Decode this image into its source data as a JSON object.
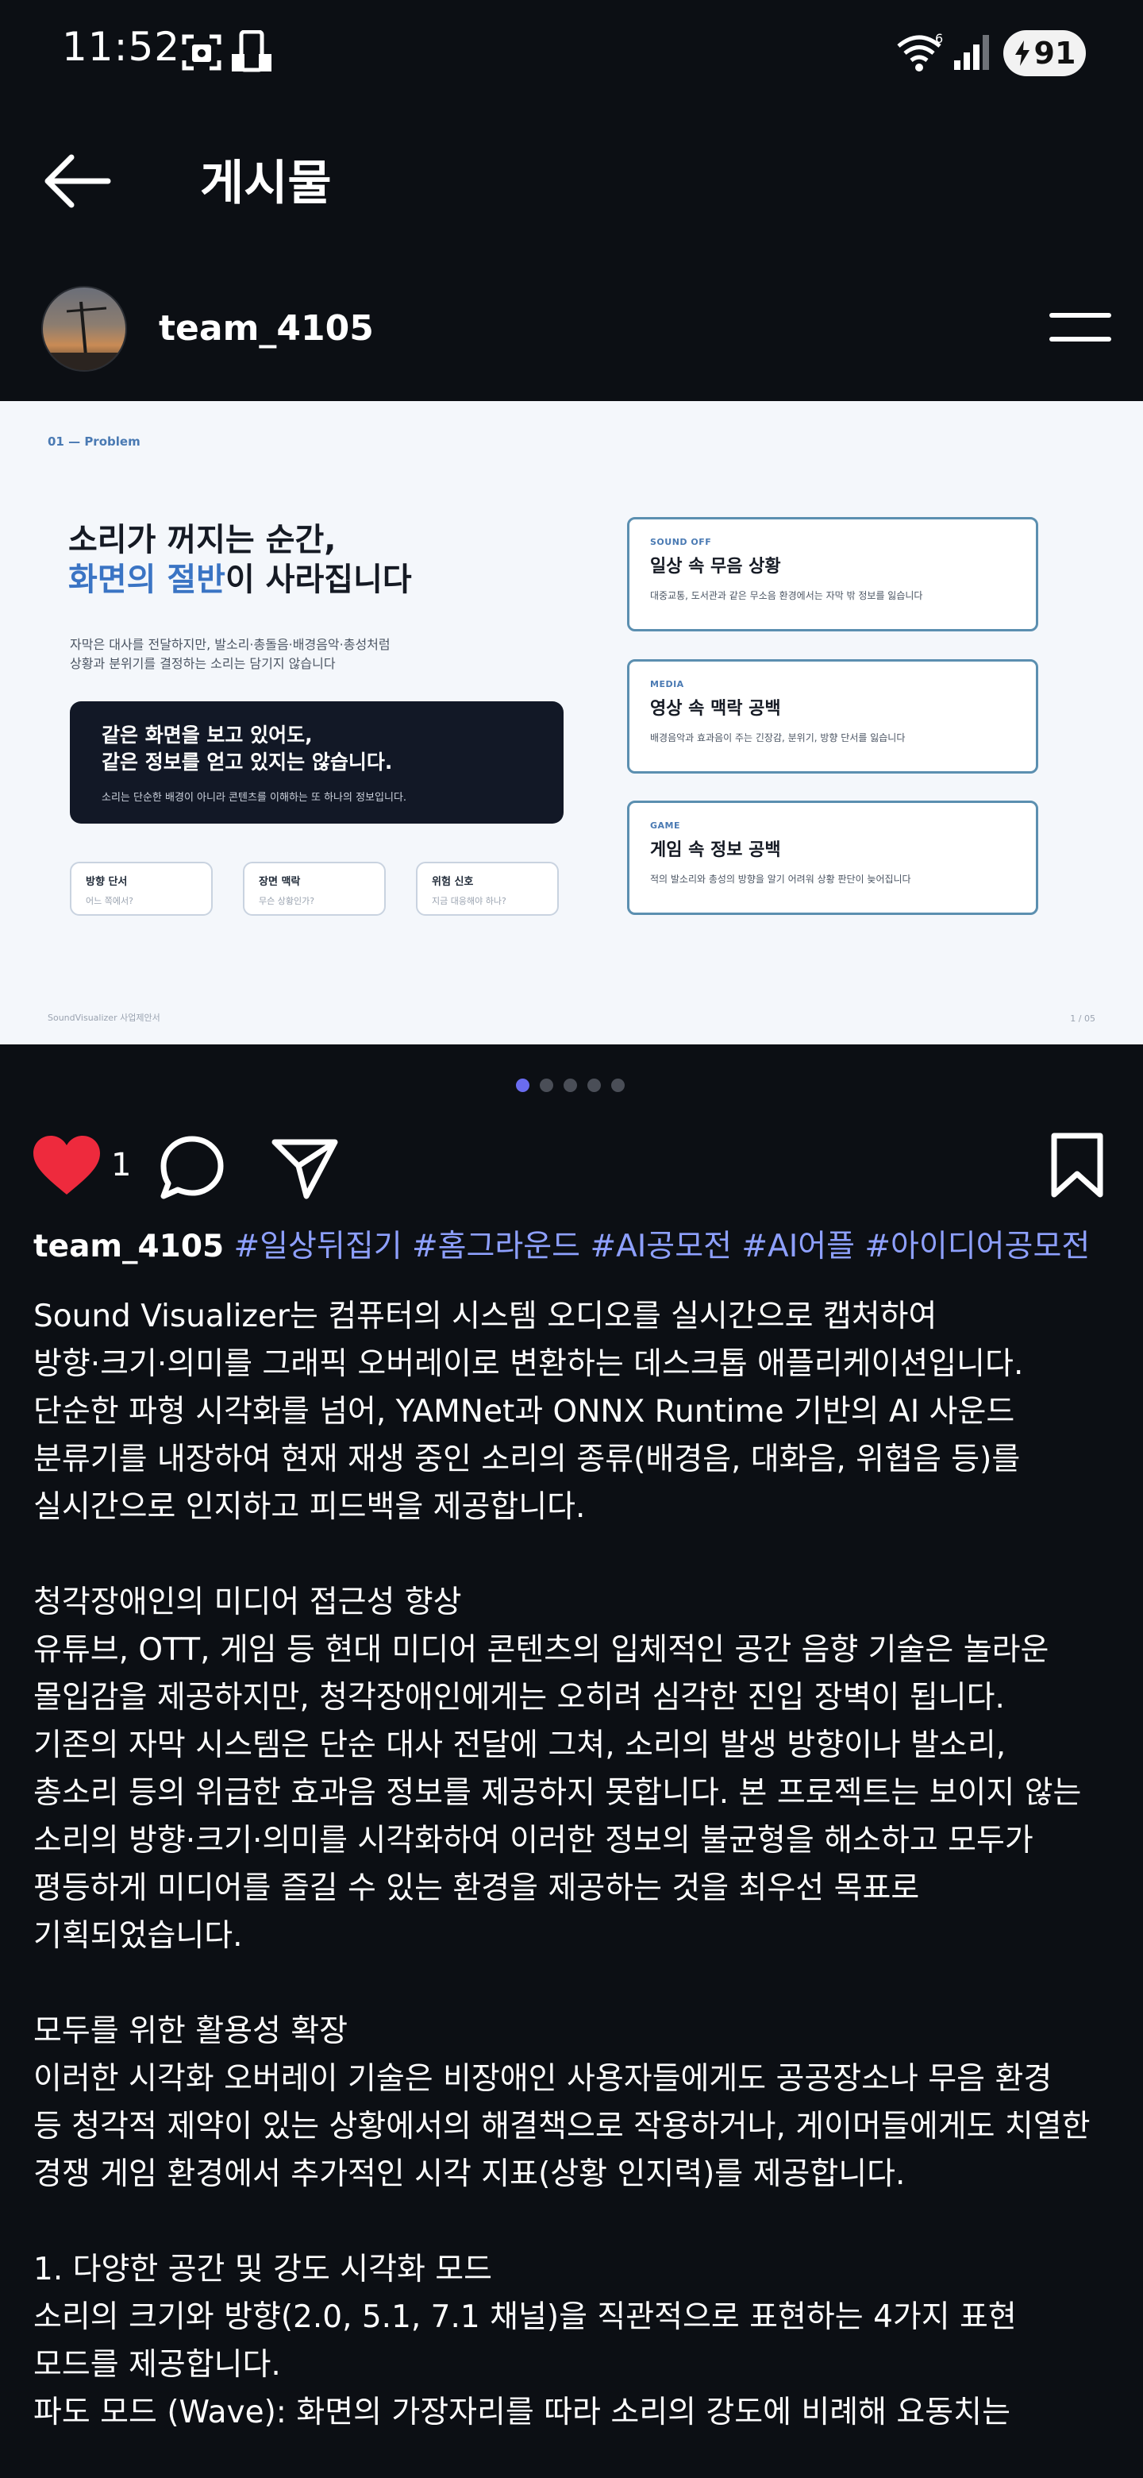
{
  "status_bar": {
    "time": "11:52",
    "battery": "91",
    "icons": [
      "screenshot-icon",
      "phone-settings-icon",
      "wifi-icon",
      "signal-icon",
      "battery-charging-icon"
    ]
  },
  "header": {
    "title": "게시물",
    "back_icon": "arrow-left-icon"
  },
  "author": {
    "username": "team_4105",
    "menu_icon": "hamburger-menu-icon"
  },
  "slide": {
    "kicker": "01 — Problem",
    "headline_line1": "소리가 꺼지는 순간,",
    "headline_line2_blue": "화면의 절반",
    "headline_line2_rest": "이 사라집니다",
    "sub_line1": "자막은 대사를 전달하지만, 발소리·총돌음·배경음악·총성처럼",
    "sub_line2": "상황과 분위기를 결정하는 소리는 담기지 않습니다",
    "box_line1": "같은 화면을 보고 있어도,",
    "box_line2": "같은 정보를 얻고 있지는 않습니다.",
    "box_note": "소리는 단순한 배경이 아니라 콘텐츠를 이해하는 또 하나의 정보입니다.",
    "pills": [
      {
        "title": "방향 단서",
        "sub": "어느 쪽에서?"
      },
      {
        "title": "장면 맥락",
        "sub": "무슨 상황인가?"
      },
      {
        "title": "위험 신호",
        "sub": "지금 대응해야 하나?"
      }
    ],
    "cards": [
      {
        "kicker": "SOUND OFF",
        "title": "일상 속 무음 상황",
        "desc": "대중교통, 도서관과 같은 무소음 환경에서는 자막 밖 정보를 잃습니다"
      },
      {
        "kicker": "MEDIA",
        "title": "영상 속 맥락 공백",
        "desc": "배경음악과 효과음이 주는 긴장감, 분위기, 방향 단서를 잃습니다"
      },
      {
        "kicker": "GAME",
        "title": "게임 속 정보 공백",
        "desc": "적의 발소리와 총성의 방향을 알기 어려워 상황 판단이 늦어집니다"
      }
    ],
    "footer_left": "SoundVisualizer 사업제안서",
    "footer_right": "1 / 05"
  },
  "pager": {
    "count": 5,
    "active": 0
  },
  "actions": {
    "like_count": "1",
    "icons": [
      "heart-icon",
      "comment-icon",
      "share-icon",
      "bookmark-icon"
    ]
  },
  "caption": {
    "owner": "team_4105",
    "hashtags": "#일상뒤집기 #홈그라운드 #AI공모전 #AI어플 #아이디어공모전",
    "para1": [
      "Sound Visualizer는 컴퓨터의 시스템 오디오를 실시간으로 캡처하여",
      "방향·크기·의미를 그래픽 오버레이로 변환하는 데스크톱 애플리케이션입니다.",
      "단순한 파형 시각화를 넘어, YAMNet과 ONNX Runtime 기반의 AI 사운드",
      "분류기를 내장하여 현재 재생 중인 소리의 종류(배경음, 대화음, 위협음 등)를",
      "실시간으로 인지하고 피드백을 제공합니다."
    ],
    "para2": [
      "청각장애인의 미디어 접근성 향상",
      "유튜브, OTT, 게임 등 현대 미디어 콘텐츠의 입체적인 공간 음향 기술은 놀라운",
      "몰입감을 제공하지만, 청각장애인에게는 오히려 심각한 진입 장벽이 됩니다.",
      "기존의 자막 시스템은 단순 대사 전달에 그쳐, 소리의 발생 방향이나 발소리,",
      "총소리 등의 위급한 효과음 정보를 제공하지 못합니다. 본 프로젝트는 보이지 않는",
      "소리의 방향·크기·의미를 시각화하여 이러한 정보의 불균형을 해소하고 모두가",
      "평등하게 미디어를 즐길 수 있는 환경을 제공하는 것을 최우선 목표로",
      "기획되었습니다."
    ],
    "para3": [
      "모두를 위한 활용성 확장",
      "이러한 시각화 오버레이 기술은 비장애인 사용자들에게도 공공장소나 무음 환경",
      "등 청각적 제약이 있는 상황에서의 해결책으로 작용하거나, 게이머들에게도 치열한",
      "경쟁 게임 환경에서 추가적인 시각 지표(상황 인지력)를 제공합니다."
    ],
    "para4": [
      "1. 다양한 공간 및 강도 시각화 모드",
      "소리의 크기와 방향(2.0, 5.1, 7.1 채널)을 직관적으로 표현하는 4가지 표현",
      "모드를 제공합니다.",
      "파도 모드 (Wave): 화면의 가장자리를 따라 소리의 강도에 비례해 요동치는"
    ]
  }
}
